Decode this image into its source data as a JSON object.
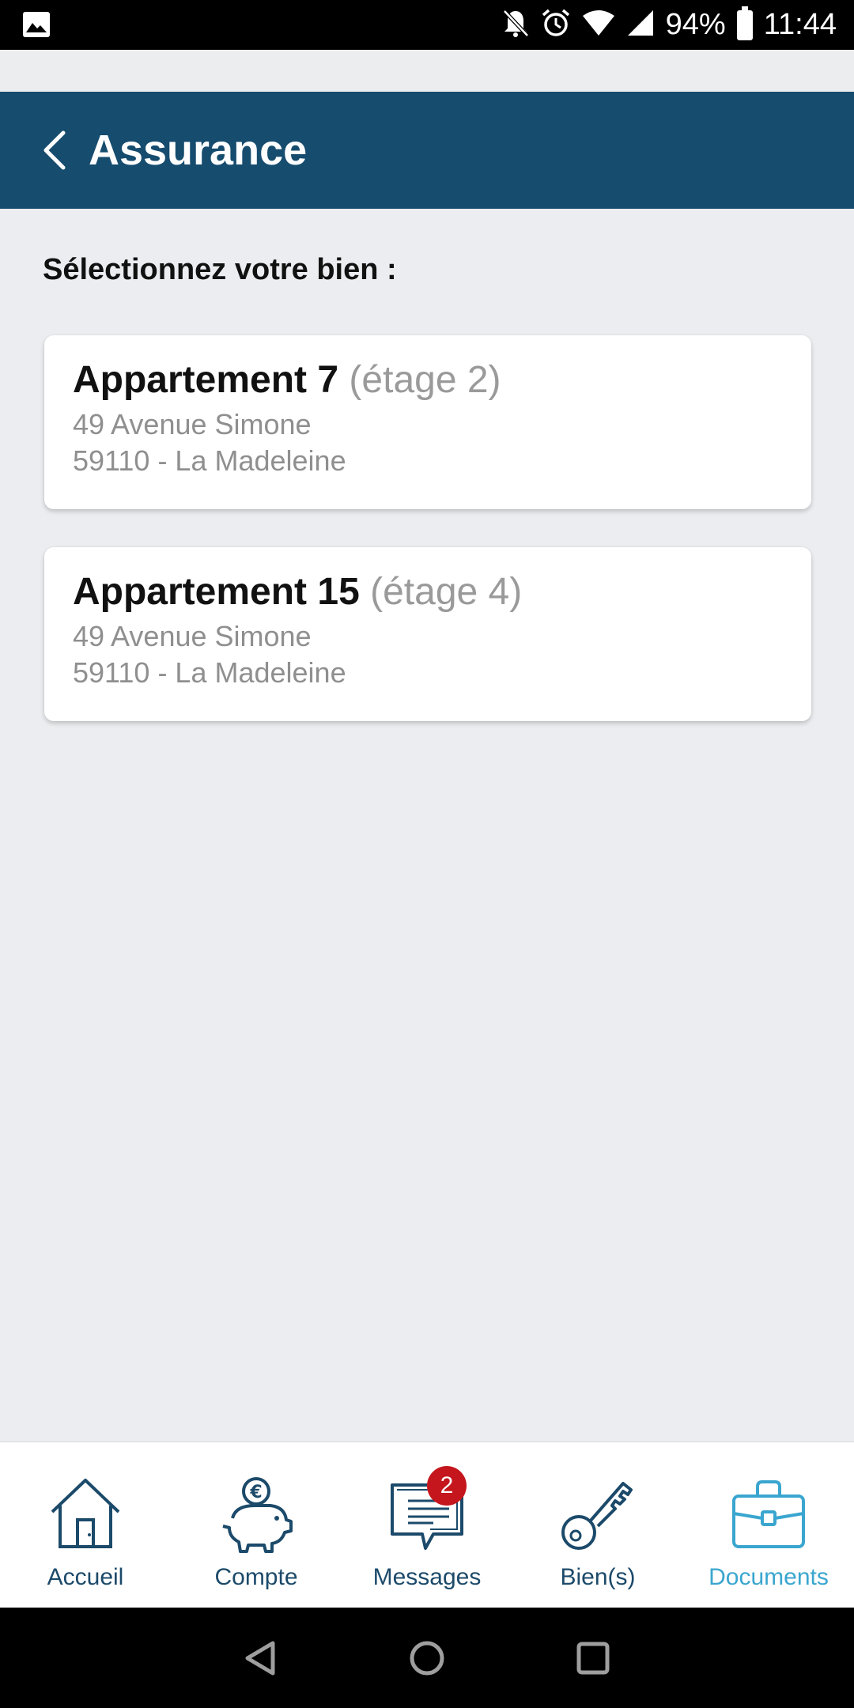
{
  "status_bar": {
    "battery": "94%",
    "time": "11:44",
    "icons": [
      "image-icon",
      "bell-off-icon",
      "alarm-icon",
      "wifi-icon",
      "signal-icon",
      "battery-icon"
    ]
  },
  "header": {
    "title": "Assurance",
    "back_icon": "chevron-left-icon",
    "background": "#164c6e"
  },
  "main": {
    "prompt": "Sélectionnez votre bien :",
    "properties": [
      {
        "name": "Appartement 7",
        "floor": "(étage 2)",
        "street": "49 Avenue Simone",
        "city": "59110 - La Madeleine"
      },
      {
        "name": "Appartement 15",
        "floor": "(étage 4)",
        "street": "49 Avenue Simone",
        "city": "59110 - La Madeleine"
      }
    ]
  },
  "bottom_nav": {
    "items": [
      {
        "label": "Accueil",
        "icon": "house-icon",
        "active": false
      },
      {
        "label": "Compte",
        "icon": "piggy-bank-euro-icon",
        "active": false
      },
      {
        "label": "Messages",
        "icon": "chat-bubble-icon",
        "active": false,
        "badge": "2"
      },
      {
        "label": "Bien(s)",
        "icon": "key-icon",
        "active": false
      },
      {
        "label": "Documents",
        "icon": "briefcase-icon",
        "active": true
      }
    ],
    "active_color": "#3aa6cf",
    "inactive_color": "#1c4a6a",
    "badge_color": "#c4161c"
  },
  "system_nav": {
    "icons": [
      "back-triangle-icon",
      "home-circle-icon",
      "recents-square-icon"
    ]
  }
}
